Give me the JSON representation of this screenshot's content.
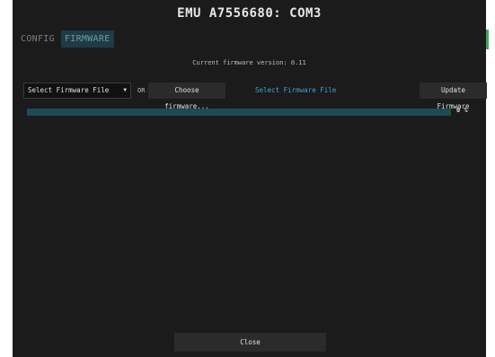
{
  "window": {
    "title": "EMU A7556680: COM3"
  },
  "tabs": [
    {
      "label": "CONFIG",
      "active": false
    },
    {
      "label": "FIRMWARE",
      "active": true
    }
  ],
  "firmware": {
    "current_version_text": "Current firmware version: 0.11",
    "select_value": "Select Firmware File",
    "or_label": "OR",
    "choose_label": "Choose firmware...",
    "selected_file_text": "Select Firmware File",
    "update_label": "Update Firmware"
  },
  "progress": {
    "value": 0,
    "text": "0 %"
  },
  "footer": {
    "close_label": "Close"
  },
  "colors": {
    "background": "#1b1b1b",
    "active_tab_bg": "#1f3b44",
    "progress_track": "#1d4a55",
    "link_blue": "#4a9ed8"
  }
}
